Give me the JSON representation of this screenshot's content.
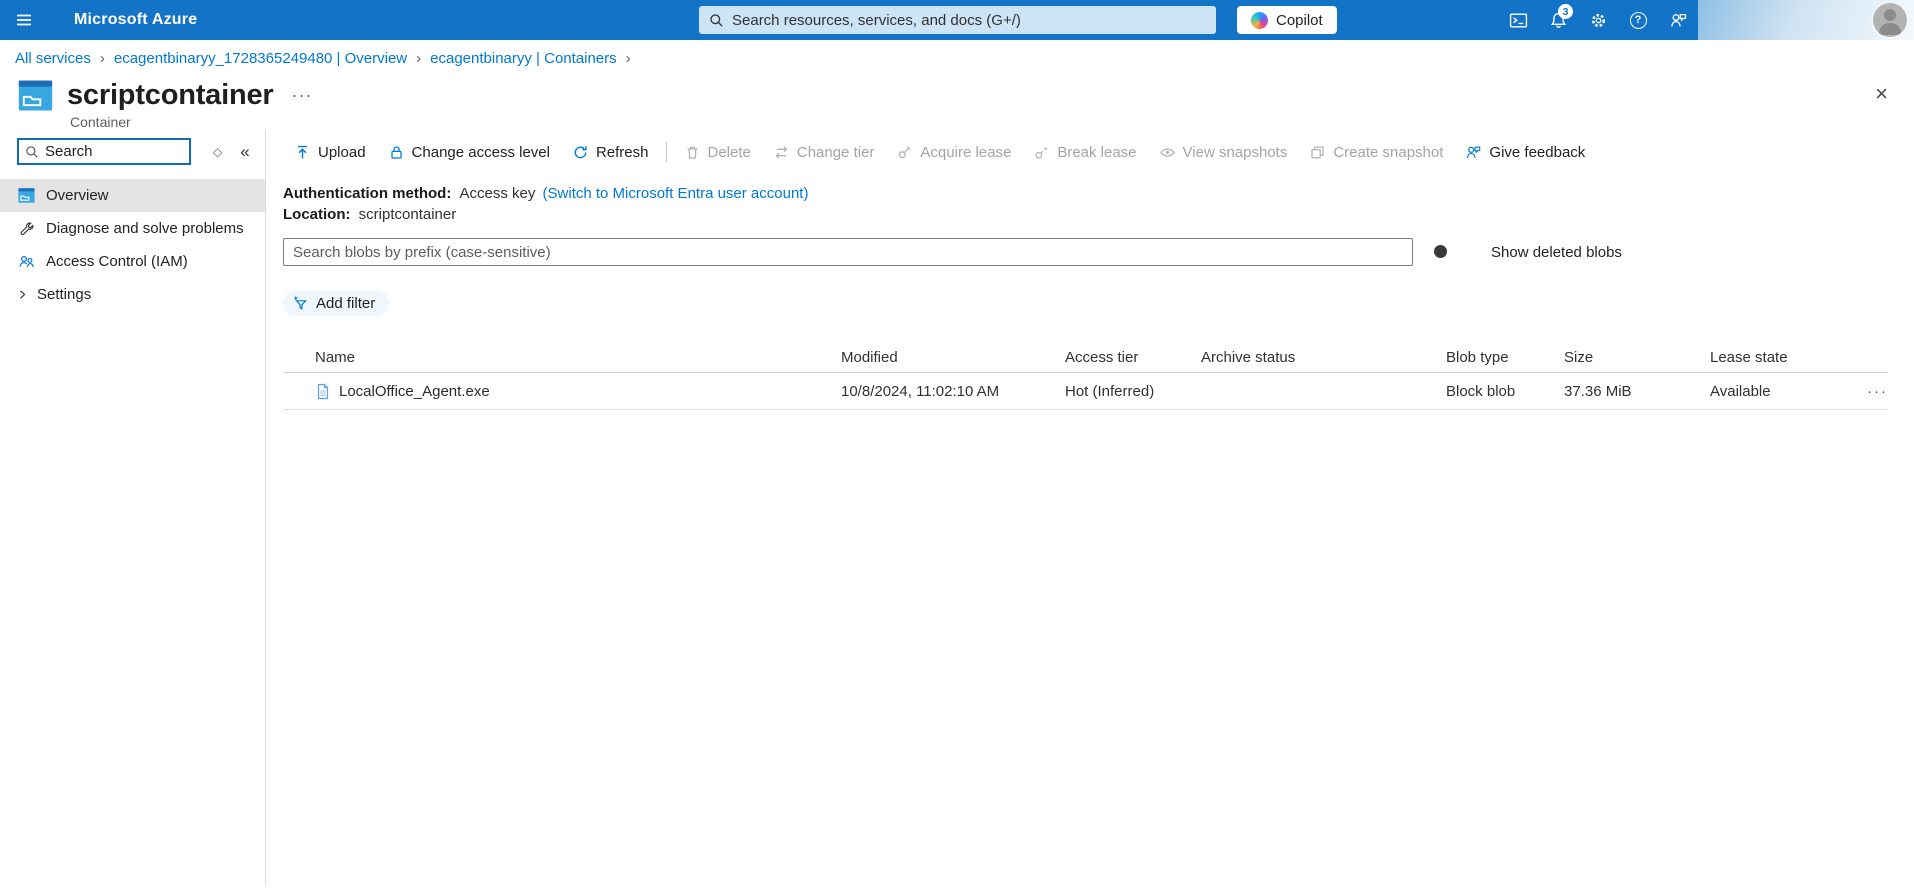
{
  "colors": {
    "accent": "#0078d4",
    "topbar_bg": "#1373c6",
    "selected_bg": "#e4e4e4"
  },
  "topbar": {
    "brand": "Microsoft Azure",
    "search_placeholder": "Search resources, services, and docs (G+/)",
    "copilot_label": "Copilot",
    "notification_count": "3"
  },
  "breadcrumb": {
    "items": [
      {
        "label": "All services"
      },
      {
        "label": "ecagentbinaryy_1728365249480 | Overview"
      },
      {
        "label": "ecagentbinaryy | Containers"
      }
    ],
    "separator": "›"
  },
  "header": {
    "title": "scriptcontainer",
    "subtitle": "Container",
    "more": "···",
    "close": "×"
  },
  "sidebar": {
    "search_placeholder": "Search",
    "diamond_glyph": "◇",
    "collapse_glyph": "«",
    "items": [
      {
        "label": "Overview",
        "selected": true
      },
      {
        "label": "Diagnose and solve problems",
        "selected": false
      },
      {
        "label": "Access Control (IAM)",
        "selected": false
      }
    ],
    "group_label": "Settings"
  },
  "toolbar": {
    "items": [
      {
        "label": "Upload",
        "enabled": true
      },
      {
        "label": "Change access level",
        "enabled": true
      },
      {
        "label": "Refresh",
        "enabled": true
      },
      {
        "label": "Delete",
        "enabled": false
      },
      {
        "label": "Change tier",
        "enabled": false
      },
      {
        "label": "Acquire lease",
        "enabled": false
      },
      {
        "label": "Break lease",
        "enabled": false
      },
      {
        "label": "View snapshots",
        "enabled": false
      },
      {
        "label": "Create snapshot",
        "enabled": false
      },
      {
        "label": "Give feedback",
        "enabled": true
      }
    ]
  },
  "meta": {
    "auth_label": "Authentication method:",
    "auth_value": "Access key",
    "auth_link": "(Switch to Microsoft Entra user account)",
    "location_label": "Location:",
    "location_value": "scriptcontainer"
  },
  "filters": {
    "blob_search_placeholder": "Search blobs by prefix (case-sensitive)",
    "toggle_label": "Show deleted blobs",
    "add_filter_label": "Add filter"
  },
  "table": {
    "headers": [
      "Name",
      "Modified",
      "Access tier",
      "Archive status",
      "Blob type",
      "Size",
      "Lease state"
    ],
    "rows": [
      {
        "name": "LocalOffice_Agent.exe",
        "modified": "10/8/2024, 11:02:10 AM",
        "access_tier": "Hot (Inferred)",
        "archive_status": "",
        "blob_type": "Block blob",
        "size": "37.36 MiB",
        "lease_state": "Available",
        "more": "···"
      }
    ]
  }
}
